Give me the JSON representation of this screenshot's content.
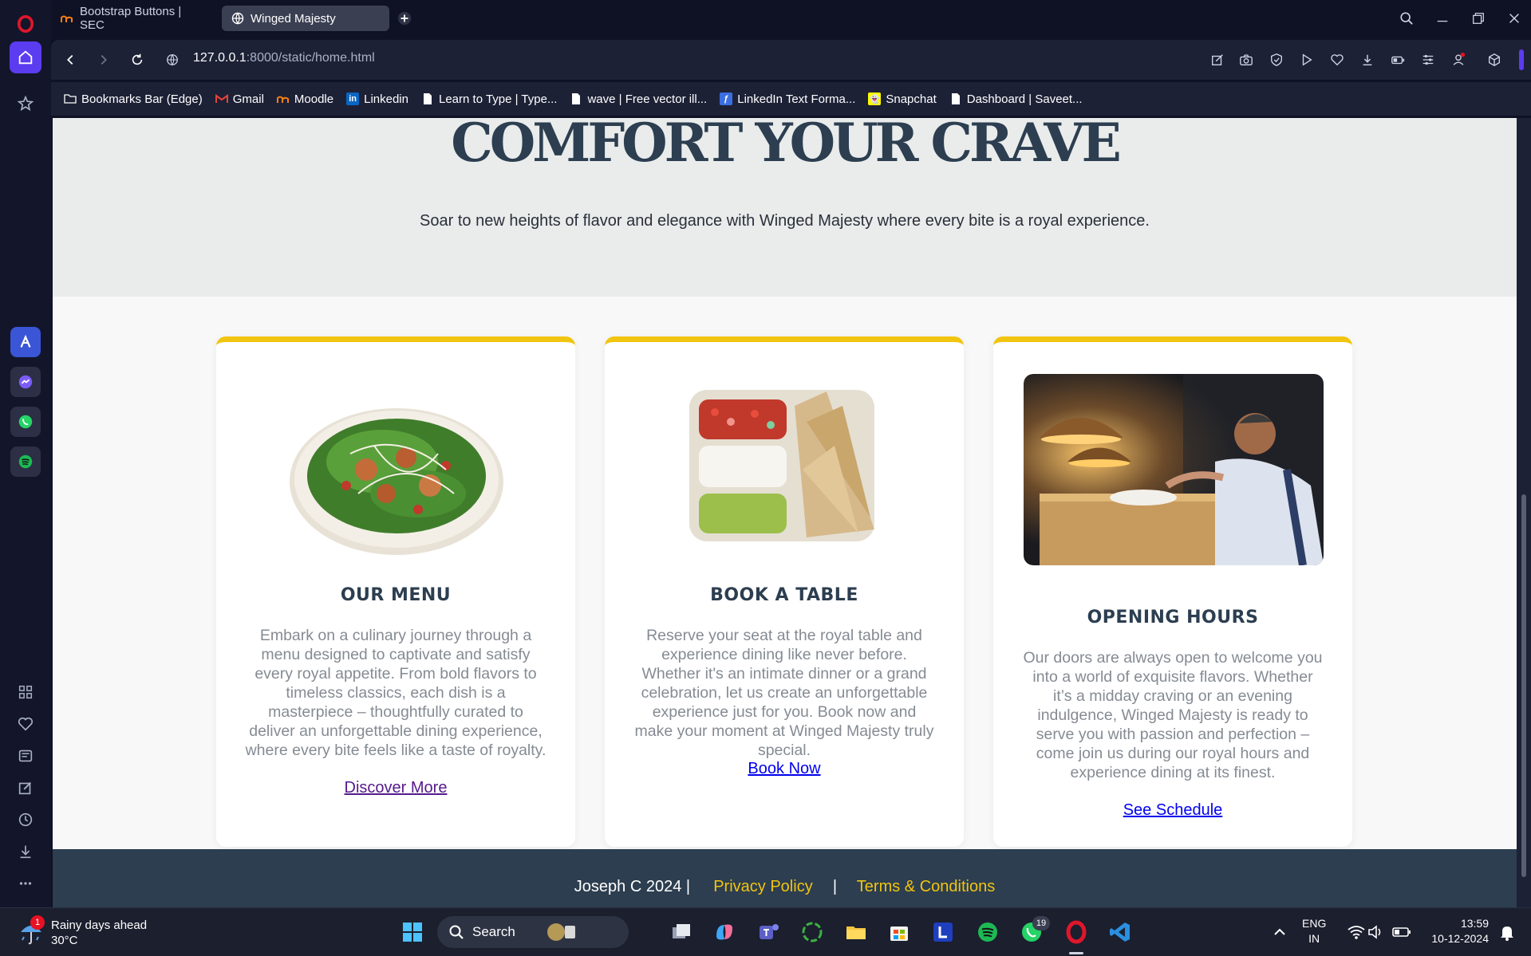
{
  "browser": {
    "tabs": [
      {
        "label": "Bootstrap Buttons | SEC"
      },
      {
        "label": "Winged Majesty"
      }
    ],
    "url": {
      "host": "127.0.0.1",
      "rest": ":8000/static/home.html"
    },
    "bookmarks": [
      {
        "label": "Bookmarks Bar (Edge)",
        "icon": "folder-icon"
      },
      {
        "label": "Gmail",
        "icon": "gmail-icon"
      },
      {
        "label": "Moodle",
        "icon": "moodle-icon"
      },
      {
        "label": "Linkedin",
        "icon": "linkedin-icon"
      },
      {
        "label": "Learn to Type | Type...",
        "icon": "page-icon"
      },
      {
        "label": "wave | Free vector ill...",
        "icon": "page-icon"
      },
      {
        "label": "LinkedIn Text Forma...",
        "icon": "app-icon"
      },
      {
        "label": "Snapchat",
        "icon": "snapchat-icon"
      },
      {
        "label": "Dashboard | Saveet...",
        "icon": "page-icon"
      }
    ],
    "accent": "#5b3cf0"
  },
  "page": {
    "hero": {
      "title": "COMFORT YOUR CRAVE",
      "subtitle": "Soar to new heights of flavor and elegance with Winged Majesty where every bite is a royal experience."
    },
    "cards": [
      {
        "title": "OUR MENU",
        "body": "Embark on a culinary journey through a menu designed to captivate and satisfy every royal appetite. From bold flavors to timeless classics, each dish is a masterpiece – thoughtfully curated to deliver an unforgettable dining experience, where every bite feels like a taste of royalty.",
        "link": "Discover More"
      },
      {
        "title": "BOOK A TABLE",
        "body": "Reserve your seat at the royal table and experience dining like never before. Whether it's an intimate dinner or a grand celebration, let us create an unforgettable experience just for you. Book now and make your moment at Winged Majesty truly special.",
        "link": "Book Now"
      },
      {
        "title": "OPENING HOURS",
        "body": "Our doors are always open to welcome you into a world of exquisite flavors. Whether it’s a midday craving or an evening indulgence, Winged Majesty is ready to serve you with passion and perfection – come join us during our royal hours and experience dining at its finest.",
        "link": "See Schedule"
      }
    ],
    "footer": {
      "copyright": "Joseph C 2024 |",
      "privacy": "Privacy Policy",
      "separator": "|",
      "terms": "Terms & Conditions"
    },
    "colors": {
      "accent": "#f1c40f",
      "heading": "#2c3e50"
    }
  },
  "taskbar": {
    "weather": {
      "title": "Rainy days ahead",
      "temp": "30°C",
      "badge": "1"
    },
    "search_placeholder": "Search",
    "whatsapp_badge": "19",
    "lang": {
      "line1": "ENG",
      "line2": "IN"
    },
    "time": "13:59",
    "date": "10-12-2024"
  }
}
